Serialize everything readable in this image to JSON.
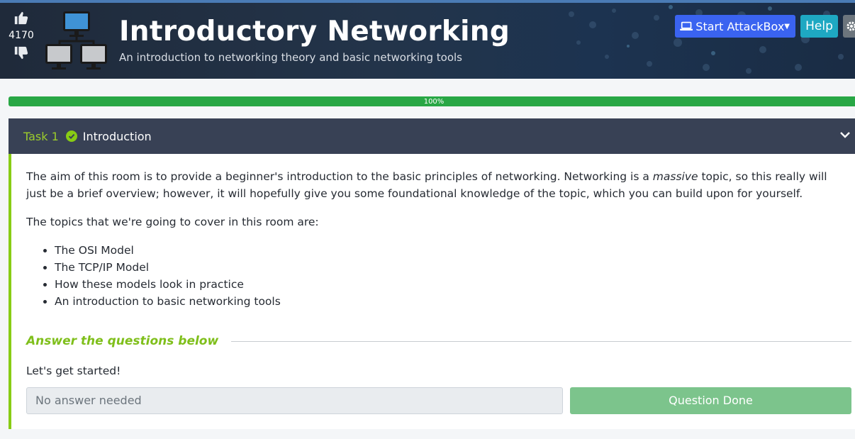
{
  "room": {
    "title": "Introductory Networking",
    "subtitle": "An introduction to networking theory and basic networking tools",
    "votes": "4170"
  },
  "header_buttons": {
    "attackbox_label": "Start AttackBox",
    "help_label": "Help"
  },
  "progress": {
    "percent": 100,
    "label": "100%"
  },
  "task": {
    "number_label": "Task 1",
    "name": "Introduction",
    "para1_a": "The aim of this room is to provide a beginner's introduction to the basic principles of networking. Networking is a ",
    "para1_em": "massive",
    "para1_b": " topic, so this really will just be a brief overview; however, it will hopefully give you some foundational knowledge of the topic, which you can build upon for yourself.",
    "para2": "The topics that we're going to cover in this room are:",
    "topics": [
      "The OSI Model",
      "The TCP/IP Model",
      "How these models look in practice",
      "An introduction to basic networking tools"
    ],
    "answer_heading": "Answer the questions below",
    "question": "Let's get started!",
    "answer_placeholder": "No answer needed",
    "done_label": "Question Done"
  },
  "colors": {
    "accent_green": "#88cc14",
    "progress_green": "#28a745",
    "attackbox_blue": "#3a63f0",
    "help_cyan": "#1ea8c2",
    "task_header": "#384155"
  },
  "icons": {
    "thumbs_up": "thumbs-up-icon",
    "thumbs_down": "thumbs-down-icon",
    "room": "network-computers-icon",
    "laptop": "laptop-icon",
    "gear": "gear-icon",
    "check": "check-circle-icon",
    "chevron": "chevron-down-icon"
  }
}
